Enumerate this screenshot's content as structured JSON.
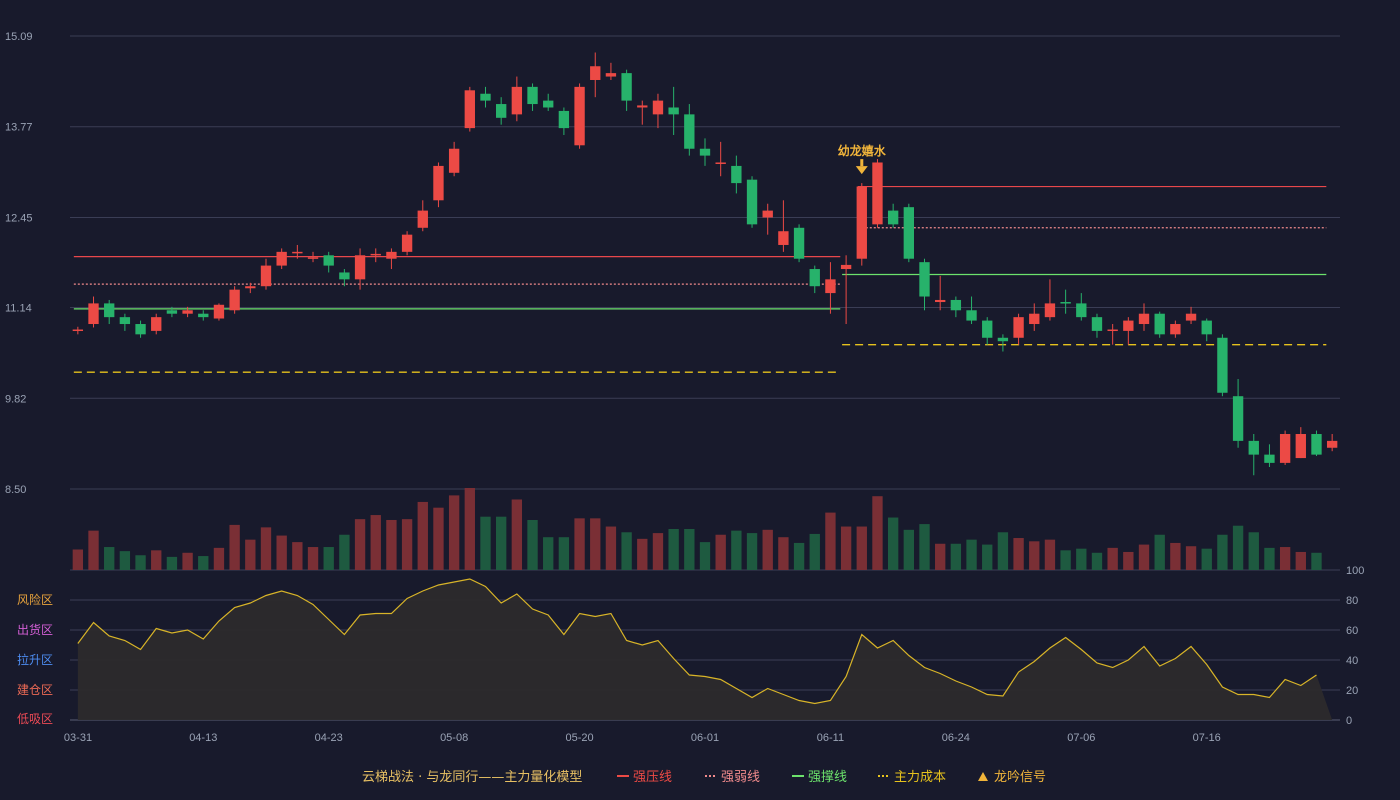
{
  "colors": {
    "background": "#181a2c",
    "grid": "#3a3d55",
    "up": "#ec4a45",
    "down": "#27b26b",
    "vol_up": "#7a2f35",
    "vol_down": "#1e5a40",
    "strong_pressure": "#e8474b",
    "strong_weak": "#f08a8c",
    "support": "#6ce26c",
    "main_cost": "#e6c21d",
    "signal": "#f0b43a",
    "osc_line": "#d8b428",
    "osc_fill": "#2c2a2c",
    "legend_title": "#e7c063"
  },
  "legend": {
    "title": "云梯战法 · 与龙同行——主力量化模型",
    "items": [
      {
        "label": "强压线",
        "marker": "line",
        "color": "#ec4a45"
      },
      {
        "label": "强弱线",
        "marker": "dash",
        "color": "#f08a8c"
      },
      {
        "label": "强撑线",
        "marker": "line",
        "color": "#6ce26c"
      },
      {
        "label": "主力成本",
        "marker": "dash",
        "color": "#e6c21d"
      },
      {
        "label": "龙吟信号",
        "marker": "triangle",
        "color": "#f0b43a"
      }
    ]
  },
  "zones": [
    {
      "label": "风险区",
      "color": "#e8a33c"
    },
    {
      "label": "出货区",
      "color": "#d45fd6"
    },
    {
      "label": "拉升区",
      "color": "#4d8cf0"
    },
    {
      "label": "建仓区",
      "color": "#ec6a55"
    },
    {
      "label": "低吸区",
      "color": "#ec4a55"
    }
  ],
  "chart_data": {
    "type": "candlestick",
    "price_axis": {
      "ticks": [
        "15.09",
        "13.77",
        "12.45",
        "11.14",
        "9.82",
        "8.50"
      ],
      "min": 8.5,
      "max": 15.09
    },
    "osc_axis": {
      "min": 0,
      "max": 100,
      "ticks": [
        {
          "label": "100",
          "value": 100,
          "color": "#39d353"
        },
        {
          "label": "80",
          "value": 80,
          "color": "#e8a33c"
        },
        {
          "label": "60",
          "value": 60,
          "color": "#d45fd6"
        },
        {
          "label": "40",
          "value": 40,
          "color": "#4d8cf0"
        },
        {
          "label": "20",
          "value": 20,
          "color": "#ec6a55"
        },
        {
          "label": "0",
          "value": 0,
          "color": "#ec4a55"
        }
      ]
    },
    "x_labels": [
      {
        "index": 0,
        "label": "03-31"
      },
      {
        "index": 8,
        "label": "04-13"
      },
      {
        "index": 16,
        "label": "04-23"
      },
      {
        "index": 24,
        "label": "05-08"
      },
      {
        "index": 32,
        "label": "05-20"
      },
      {
        "index": 40,
        "label": "06-01"
      },
      {
        "index": 48,
        "label": "06-11"
      },
      {
        "index": 56,
        "label": "06-24"
      },
      {
        "index": 64,
        "label": "07-06"
      },
      {
        "index": 72,
        "label": "07-16"
      }
    ],
    "candles": [
      [
        10.8,
        10.82,
        10.75,
        10.86
      ],
      [
        10.9,
        11.2,
        10.85,
        11.3
      ],
      [
        11.2,
        11.0,
        10.9,
        11.25
      ],
      [
        11.0,
        10.9,
        10.8,
        11.05
      ],
      [
        10.9,
        10.75,
        10.7,
        10.95
      ],
      [
        10.8,
        11.0,
        10.75,
        11.05
      ],
      [
        11.1,
        11.05,
        11.0,
        11.15
      ],
      [
        11.05,
        11.1,
        11.0,
        11.15
      ],
      [
        11.05,
        11.0,
        10.95,
        11.1
      ],
      [
        10.98,
        11.18,
        10.95,
        11.2
      ],
      [
        11.1,
        11.4,
        11.05,
        11.45
      ],
      [
        11.42,
        11.45,
        11.35,
        11.5
      ],
      [
        11.45,
        11.75,
        11.4,
        11.85
      ],
      [
        11.75,
        11.95,
        11.7,
        12.0
      ],
      [
        11.95,
        11.95,
        11.85,
        12.05
      ],
      [
        11.85,
        11.87,
        11.8,
        11.95
      ],
      [
        11.9,
        11.75,
        11.65,
        11.95
      ],
      [
        11.65,
        11.55,
        11.45,
        11.7
      ],
      [
        11.55,
        11.9,
        11.4,
        12.0
      ],
      [
        11.9,
        11.92,
        11.8,
        12.0
      ],
      [
        11.85,
        11.95,
        11.7,
        12.0
      ],
      [
        11.95,
        12.2,
        11.9,
        12.25
      ],
      [
        12.3,
        12.55,
        12.25,
        12.7
      ],
      [
        12.7,
        13.2,
        12.6,
        13.25
      ],
      [
        13.1,
        13.45,
        13.05,
        13.55
      ],
      [
        13.75,
        14.3,
        13.7,
        14.35
      ],
      [
        14.25,
        14.15,
        14.05,
        14.35
      ],
      [
        14.1,
        13.9,
        13.8,
        14.2
      ],
      [
        13.95,
        14.35,
        13.85,
        14.5
      ],
      [
        14.35,
        14.1,
        14.0,
        14.4
      ],
      [
        14.15,
        14.05,
        14.0,
        14.25
      ],
      [
        14.0,
        13.75,
        13.65,
        14.05
      ],
      [
        13.5,
        14.35,
        13.45,
        14.4
      ],
      [
        14.45,
        14.65,
        14.2,
        14.85
      ],
      [
        14.5,
        14.55,
        14.45,
        14.7
      ],
      [
        14.55,
        14.15,
        14.0,
        14.6
      ],
      [
        14.05,
        14.08,
        13.8,
        14.15
      ],
      [
        13.95,
        14.15,
        13.75,
        14.25
      ],
      [
        14.05,
        13.95,
        13.65,
        14.35
      ],
      [
        13.95,
        13.45,
        13.35,
        14.1
      ],
      [
        13.45,
        13.35,
        13.2,
        13.6
      ],
      [
        13.25,
        13.25,
        13.05,
        13.55
      ],
      [
        13.2,
        12.95,
        12.8,
        13.35
      ],
      [
        13.0,
        12.35,
        12.3,
        13.05
      ],
      [
        12.45,
        12.55,
        12.2,
        12.65
      ],
      [
        12.05,
        12.25,
        11.95,
        12.7
      ],
      [
        12.3,
        11.85,
        11.8,
        12.35
      ],
      [
        11.7,
        11.45,
        11.35,
        11.75
      ],
      [
        11.35,
        11.55,
        11.05,
        11.8
      ],
      [
        11.7,
        11.76,
        10.9,
        11.9
      ],
      [
        11.85,
        12.9,
        11.75,
        12.95
      ],
      [
        12.35,
        13.25,
        12.3,
        13.3
      ],
      [
        12.55,
        12.35,
        12.3,
        12.65
      ],
      [
        12.6,
        11.85,
        11.8,
        12.65
      ],
      [
        11.8,
        11.3,
        11.1,
        11.85
      ],
      [
        11.22,
        11.25,
        11.1,
        11.6
      ],
      [
        11.25,
        11.1,
        11.0,
        11.3
      ],
      [
        11.1,
        10.95,
        10.9,
        11.3
      ],
      [
        10.95,
        10.7,
        10.6,
        11.0
      ],
      [
        10.7,
        10.65,
        10.5,
        10.75
      ],
      [
        10.7,
        11.0,
        10.6,
        11.05
      ],
      [
        10.9,
        11.05,
        10.8,
        11.2
      ],
      [
        11.0,
        11.2,
        10.95,
        11.55
      ],
      [
        11.22,
        11.2,
        11.05,
        11.4
      ],
      [
        11.2,
        11.0,
        10.95,
        11.35
      ],
      [
        11.0,
        10.8,
        10.7,
        11.05
      ],
      [
        10.8,
        10.82,
        10.6,
        10.9
      ],
      [
        10.8,
        10.95,
        10.6,
        11.0
      ],
      [
        10.9,
        11.05,
        10.8,
        11.2
      ],
      [
        11.05,
        10.75,
        10.7,
        11.08
      ],
      [
        10.75,
        10.9,
        10.7,
        10.95
      ],
      [
        10.95,
        11.05,
        10.9,
        11.15
      ],
      [
        10.95,
        10.75,
        10.65,
        10.98
      ],
      [
        10.7,
        9.9,
        9.85,
        10.75
      ],
      [
        9.85,
        9.2,
        9.1,
        10.1
      ],
      [
        9.2,
        9.0,
        8.7,
        9.3
      ],
      [
        9.0,
        8.88,
        8.82,
        9.15
      ],
      [
        8.88,
        9.3,
        8.85,
        9.35
      ],
      [
        8.95,
        9.3,
        8.95,
        9.4
      ],
      [
        9.3,
        9.0,
        8.98,
        9.35
      ],
      [
        9.1,
        9.2,
        9.05,
        9.3
      ]
    ],
    "volume": [
      0.25,
      0.48,
      0.28,
      0.23,
      0.18,
      0.24,
      0.16,
      0.21,
      0.17,
      0.27,
      0.55,
      0.37,
      0.52,
      0.42,
      0.34,
      0.28,
      0.28,
      0.43,
      0.62,
      0.67,
      0.61,
      0.62,
      0.83,
      0.76,
      0.91,
      1.0,
      0.65,
      0.65,
      0.86,
      0.61,
      0.4,
      0.4,
      0.63,
      0.63,
      0.53,
      0.46,
      0.38,
      0.45,
      0.5,
      0.5,
      0.34,
      0.43,
      0.48,
      0.45,
      0.49,
      0.4,
      0.33,
      0.44,
      0.7,
      0.53,
      0.53,
      0.9,
      0.64,
      0.49,
      0.56,
      0.32,
      0.32,
      0.37,
      0.31,
      0.46,
      0.39,
      0.35,
      0.37,
      0.24,
      0.26,
      0.21,
      0.27,
      0.22,
      0.31,
      0.43,
      0.33,
      0.29,
      0.26,
      0.43,
      0.54,
      0.46,
      0.27,
      0.28,
      0.22,
      0.21
    ],
    "oscillator": [
      51,
      65,
      56,
      53,
      47,
      61,
      58,
      60,
      54,
      66,
      75,
      78,
      83,
      86,
      83,
      77,
      67,
      57,
      70,
      71,
      71,
      81,
      86,
      90,
      92,
      94,
      89,
      78,
      84,
      74,
      70,
      57,
      71,
      69,
      71,
      53,
      50,
      53,
      41,
      30,
      29,
      27,
      21,
      15,
      21,
      17,
      13,
      11,
      13,
      29,
      57,
      48,
      53,
      43,
      35,
      31,
      26,
      22,
      17,
      16,
      32,
      39,
      48,
      55,
      47,
      38,
      35,
      40,
      49,
      36,
      41,
      49,
      37,
      22,
      17,
      17,
      15,
      27,
      23,
      30
    ],
    "levels": [
      {
        "name": "强压线",
        "segments": [
          {
            "from": 0,
            "to": 48,
            "value": 11.88
          },
          {
            "from": 50,
            "to": 79,
            "value": 12.9
          }
        ]
      },
      {
        "name": "强弱线",
        "segments": [
          {
            "from": 0,
            "to": 48,
            "value": 11.48
          },
          {
            "from": 50,
            "to": 79,
            "value": 12.3
          }
        ]
      },
      {
        "name": "强撑线",
        "segments": [
          {
            "from": 0,
            "to": 48,
            "value": 11.12
          },
          {
            "from": 49,
            "to": 79,
            "value": 11.62
          }
        ]
      },
      {
        "name": "主力成本",
        "segments": [
          {
            "from": 0,
            "to": 48,
            "value": 10.2
          },
          {
            "from": 49,
            "to": 79,
            "value": 10.6
          }
        ]
      }
    ],
    "signals": [
      {
        "index": 50,
        "label": "幼龙嬉水"
      }
    ]
  }
}
